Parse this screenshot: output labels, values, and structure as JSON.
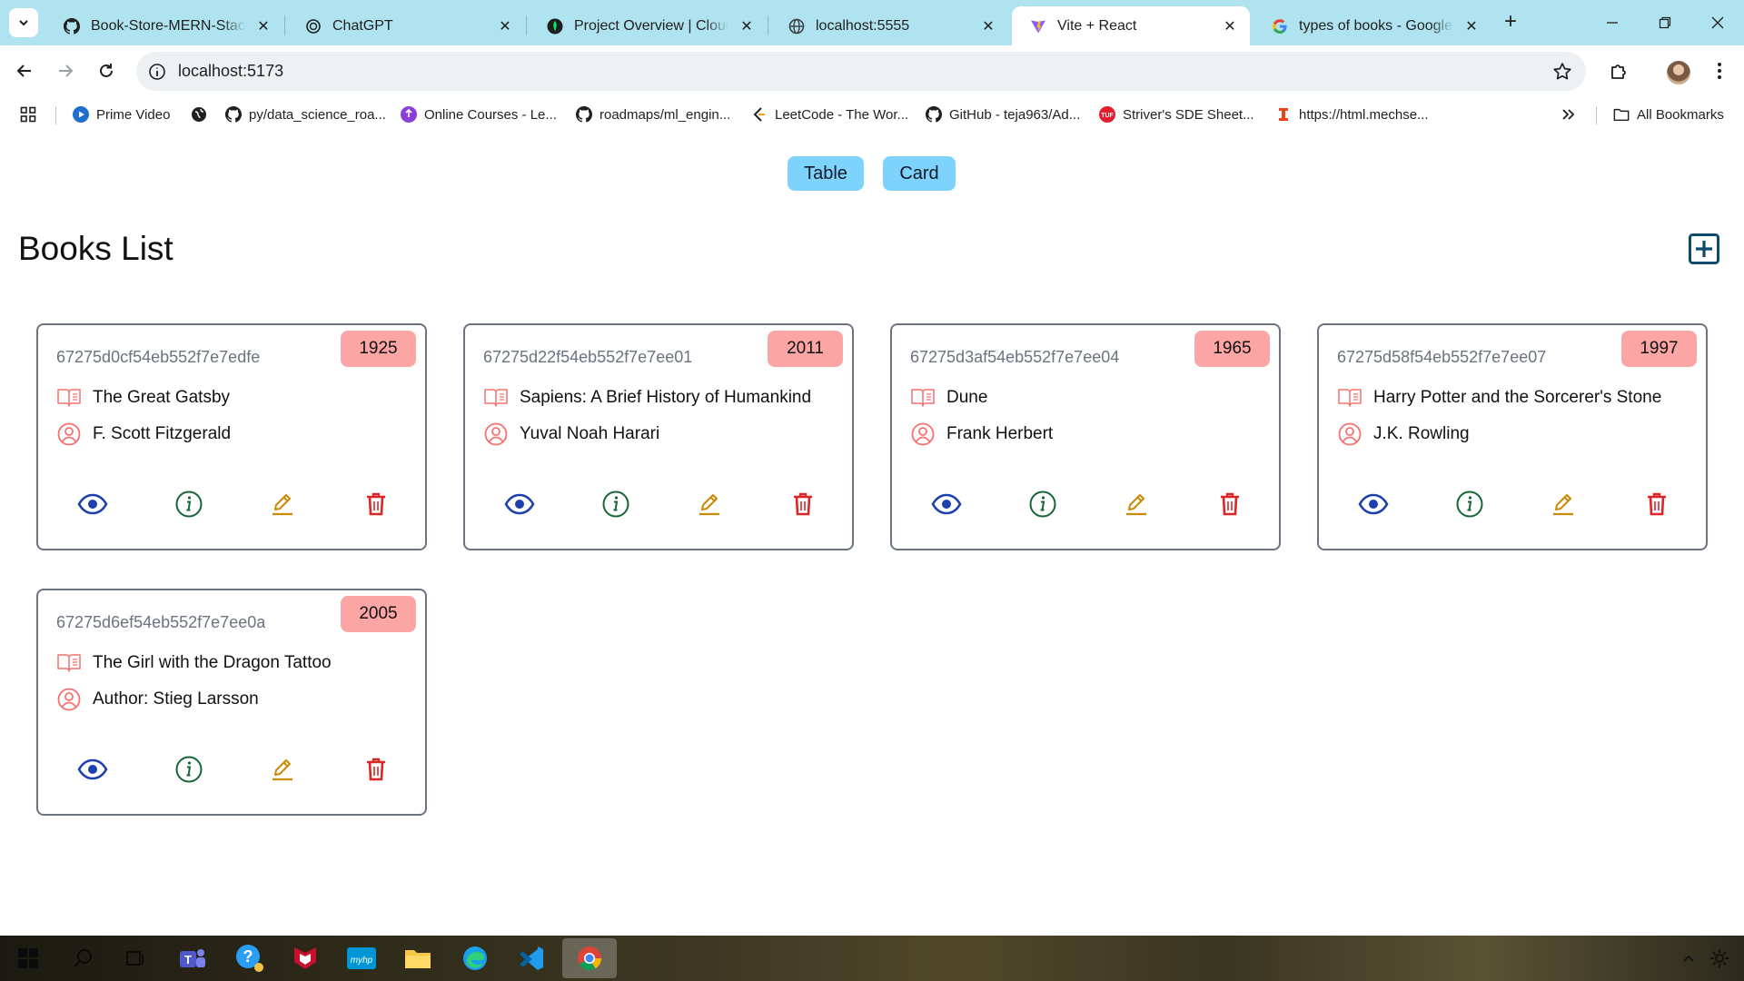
{
  "browser": {
    "tabs": [
      {
        "title": "Book-Store-MERN-Stack/b",
        "favicon": "github-icon",
        "active": false
      },
      {
        "title": "ChatGPT",
        "favicon": "chatgpt-icon",
        "active": false
      },
      {
        "title": "Project Overview | Cloud: M",
        "favicon": "mongodb-leaf-icon",
        "active": false
      },
      {
        "title": "localhost:5555",
        "favicon": "globe-icon",
        "active": false
      },
      {
        "title": "Vite + React",
        "favicon": "vite-icon",
        "active": true
      },
      {
        "title": "types of books - Google Se",
        "favicon": "google-icon",
        "active": false
      }
    ],
    "address": "localhost:5173",
    "bookmarks": [
      {
        "label": "Prime Video",
        "icon": "prime-video-icon"
      },
      {
        "label": "",
        "icon": "globe-dark-icon"
      },
      {
        "label": "py/data_science_roa...",
        "icon": "github-icon"
      },
      {
        "label": "Online Courses - Le...",
        "icon": "courses-icon"
      },
      {
        "label": "roadmaps/ml_engin...",
        "icon": "github-icon"
      },
      {
        "label": "LeetCode - The Wor...",
        "icon": "leetcode-icon"
      },
      {
        "label": "GitHub - teja963/Ad...",
        "icon": "github-icon"
      },
      {
        "label": "Striver's SDE Sheet...",
        "icon": "tuf-icon"
      },
      {
        "label": "https://html.mechse...",
        "icon": "mechse-icon"
      }
    ],
    "all_bookmarks_label": "All Bookmarks"
  },
  "page": {
    "view_buttons": {
      "table": "Table",
      "card": "Card"
    },
    "title": "Books List",
    "books": [
      {
        "id": "67275d0cf54eb552f7e7edfe",
        "year": "1925",
        "title": "The Great Gatsby",
        "author": "F. Scott Fitzgerald"
      },
      {
        "id": "67275d22f54eb552f7e7ee01",
        "year": "2011",
        "title": "Sapiens: A Brief History of Humankind",
        "author": "Yuval Noah Harari"
      },
      {
        "id": "67275d3af54eb552f7e7ee04",
        "year": "1965",
        "title": "Dune",
        "author": "Frank Herbert"
      },
      {
        "id": "67275d58f54eb552f7e7ee07",
        "year": "1997",
        "title": "Harry Potter and the Sorcerer's Stone",
        "author": "J.K. Rowling"
      },
      {
        "id": "67275d6ef54eb552f7e7ee0a",
        "year": "2005",
        "title": "The Girl with the Dragon Tattoo",
        "author": "Author: Stieg Larsson"
      }
    ]
  },
  "colors": {
    "view_button_bg": "#7dd3fc",
    "year_badge_bg": "#fca5a5",
    "show_icon": "#1e40af",
    "info_icon": "#166534",
    "edit_icon": "#ca8a04",
    "delete_icon": "#dc2626",
    "row_icon": "#f87171",
    "add_icon": "#0c4a6e"
  }
}
